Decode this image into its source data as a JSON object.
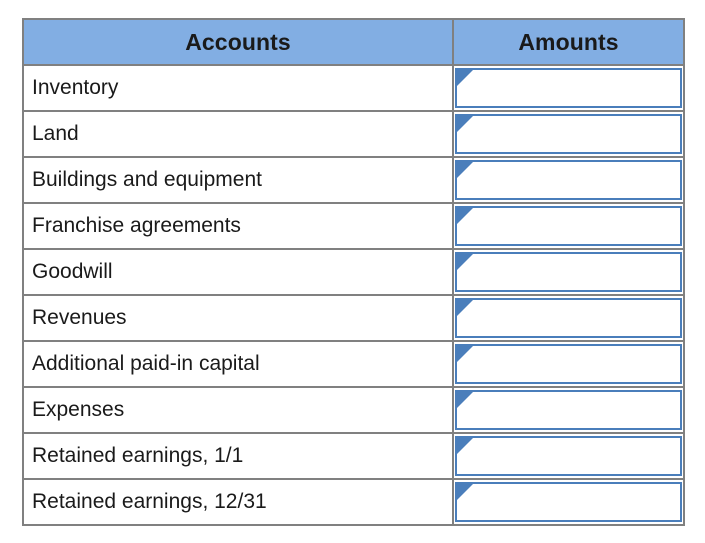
{
  "worksheet": {
    "columns": [
      {
        "key": "accounts",
        "label": "Accounts"
      },
      {
        "key": "amounts",
        "label": "Amounts"
      }
    ],
    "rows": [
      {
        "account": "Inventory",
        "amount": "",
        "placeholder": ""
      },
      {
        "account": "Land",
        "amount": "",
        "placeholder": ""
      },
      {
        "account": "Buildings and equipment",
        "amount": "",
        "placeholder": ""
      },
      {
        "account": "Franchise agreements",
        "amount": "",
        "placeholder": ""
      },
      {
        "account": "Goodwill",
        "amount": "",
        "placeholder": ""
      },
      {
        "account": "Revenues",
        "amount": "",
        "placeholder": ""
      },
      {
        "account": "Additional paid-in capital",
        "amount": "",
        "placeholder": ""
      },
      {
        "account": "Expenses",
        "amount": "",
        "placeholder": ""
      },
      {
        "account": "Retained earnings, 1/1",
        "amount": "",
        "placeholder": ""
      },
      {
        "account": "Retained earnings, 12/31",
        "amount": "",
        "placeholder": ""
      }
    ],
    "colors": {
      "header_fill": "#82aee3",
      "grid_line": "#808080",
      "input_border": "#4a7ebb",
      "input_fill": "#ffffff",
      "text": "#1a1a1a"
    },
    "icons": {
      "corner_marker": "triangle-right-icon"
    }
  }
}
